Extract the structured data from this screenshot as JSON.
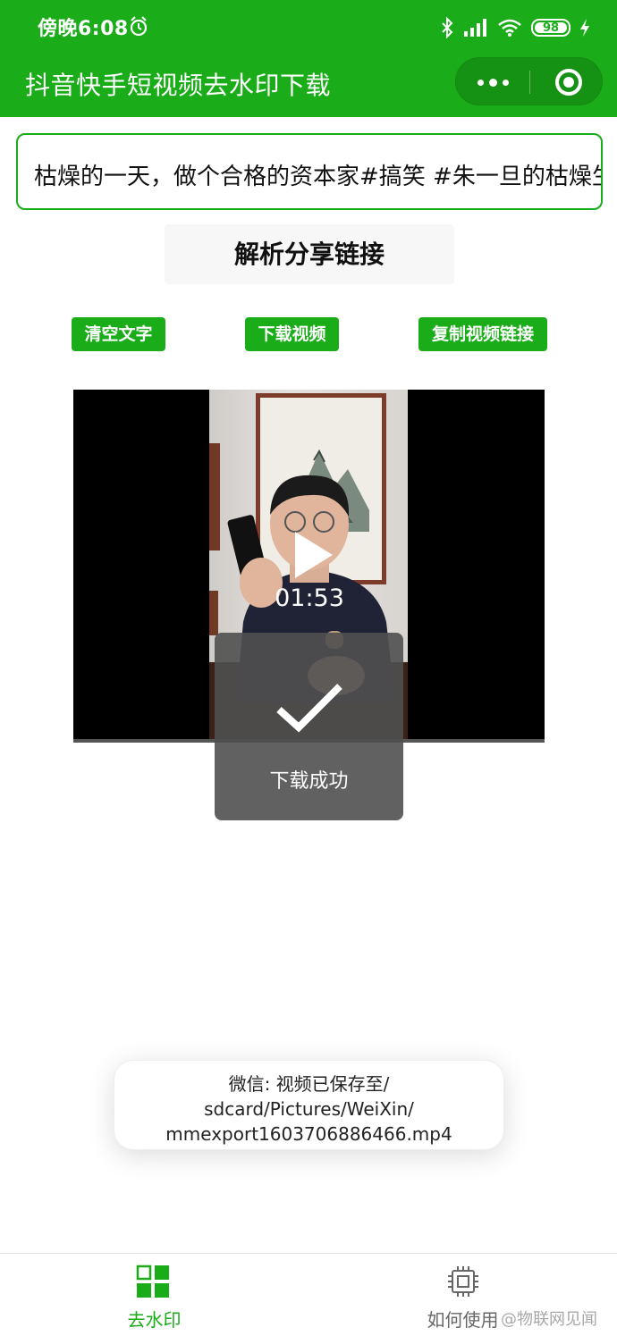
{
  "status_bar": {
    "time": "傍晚6:08",
    "battery_level": "98"
  },
  "nav": {
    "title": "抖音快手短视频去水印下载"
  },
  "link_input": {
    "value": "枯燥的一天，做个合格的资本家#搞笑 #朱一旦的枯燥生活"
  },
  "parse_button": {
    "label": "解析分享链接"
  },
  "actions": {
    "clear_label": "清空文字",
    "download_label": "下载视频",
    "copy_label": "复制视频链接"
  },
  "video": {
    "duration": "01:53"
  },
  "toast": {
    "message": "下载成功"
  },
  "save_tip": {
    "line1": "微信: 视频已保存至/",
    "line2": "sdcard/Pictures/WeiXin/",
    "line3": "mmexport1603706886466.mp4"
  },
  "tabbar": {
    "tabs": [
      {
        "label": "去水印",
        "icon": "grid-icon",
        "active": true
      },
      {
        "label": "如何使用",
        "icon": "chip-icon",
        "active": false
      }
    ]
  },
  "watermark": {
    "text": "@物联网见闻"
  },
  "colors": {
    "brand": "#1aad19",
    "toast_bg": "#505050"
  }
}
